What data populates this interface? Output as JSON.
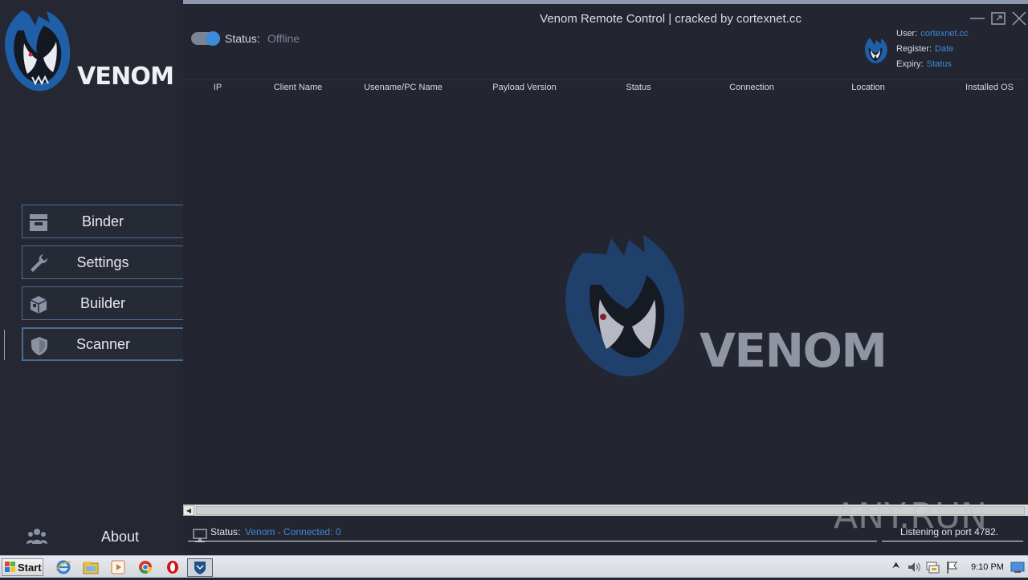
{
  "window": {
    "title": "Venom Remote Control | cracked by cortexnet.cc",
    "controls": [
      "minimize-icon",
      "restore-icon",
      "close-icon"
    ]
  },
  "brand": {
    "logo_text": "VENOM"
  },
  "header": {
    "status_label": "Status:",
    "status_value": "Offline",
    "toggle_on": true,
    "user_label": "User:",
    "user_value": "cortexnet.cc",
    "register_label": "Register:",
    "register_value": "Date",
    "expiry_label": "Expiry:",
    "expiry_value": "Status"
  },
  "sidebar": {
    "items": [
      {
        "label": "Binder",
        "icon": "inbox-tray-icon"
      },
      {
        "label": "Settings",
        "icon": "wrench-icon"
      },
      {
        "label": "Builder",
        "icon": "package-box-icon"
      },
      {
        "label": "Scanner",
        "icon": "shield-icon",
        "active": true
      }
    ],
    "about_label": "About",
    "about_icon": "people-group-icon"
  },
  "table": {
    "columns": [
      "IP",
      "Client Name",
      "Usename/PC Name",
      "Payload Version",
      "Status",
      "Connection",
      "Location",
      "Installed OS"
    ],
    "rows": []
  },
  "statusbar": {
    "status_label": "Status:",
    "status_value": "Venom - Connected: 0",
    "listening_text": "Listening on port 4782."
  },
  "watermark": {
    "text": "ANY.RUN"
  },
  "taskbar": {
    "start_label": "Start",
    "clock": "9:10 PM",
    "apps": [
      "internet-explorer-icon",
      "folder-icon",
      "media-player-icon",
      "chrome-icon",
      "opera-icon",
      "venom-app-icon"
    ]
  },
  "colors": {
    "background": "#232631",
    "accent": "#3f8ad8",
    "button_border": "#4a6d96",
    "text": "#d5d9df"
  }
}
